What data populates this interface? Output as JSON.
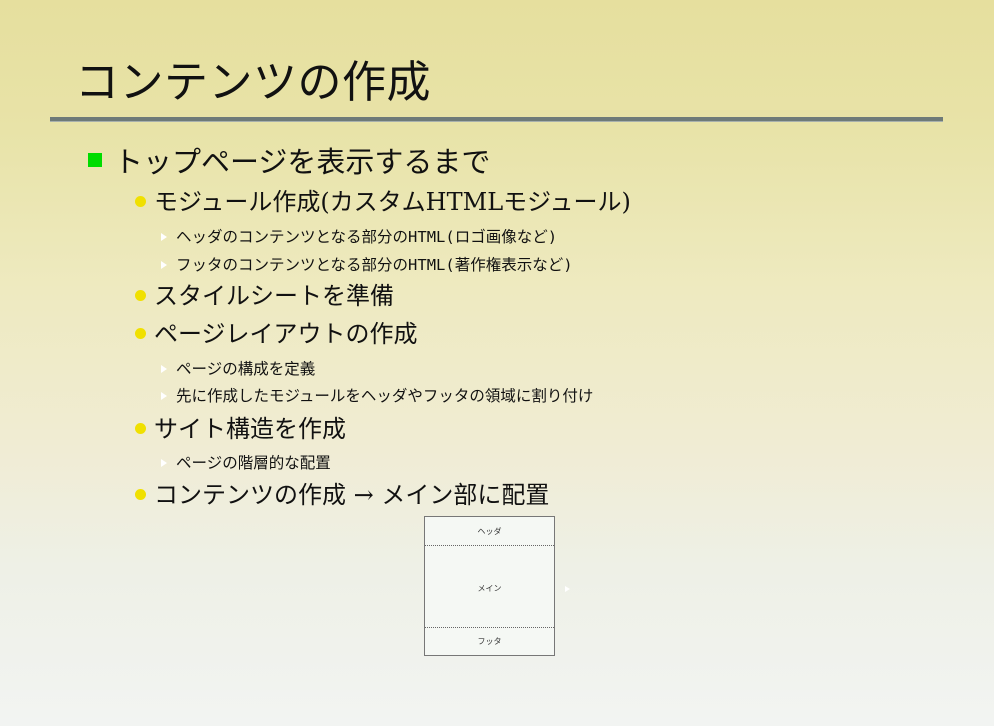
{
  "slide": {
    "title": "コンテンツの作成",
    "level1": {
      "text": "トップページを表示するまで"
    },
    "items": [
      {
        "text": "モジュール作成(カスタムHTMLモジュール)",
        "sub": [
          "ヘッダのコンテンツとなる部分のHTML(ロゴ画像など)",
          "フッタのコンテンツとなる部分のHTML(著作権表示など)"
        ]
      },
      {
        "text": "スタイルシートを準備",
        "sub": []
      },
      {
        "text": "ページレイアウトの作成",
        "sub": [
          "ページの構成を定義",
          "先に作成したモジュールをヘッダやフッタの領域に割り付け"
        ]
      },
      {
        "text": "サイト構造を作成",
        "sub": [
          "ページの階層的な配置"
        ]
      },
      {
        "text": "コンテンツの作成 → メイン部に配置",
        "sub": []
      }
    ],
    "diagram": {
      "header_label": "ヘッダ",
      "main_label": "メイン",
      "footer_label": "フッタ"
    }
  },
  "colors": {
    "level1_bullet": "#00dc00",
    "level2_bullet": "#f0e000",
    "title_rule": "#6e7a78"
  },
  "icons": {
    "level1_bullet": "green-square-bullet-icon",
    "level2_bullet": "yellow-dot-bullet-icon",
    "level3_bullet": "white-triangle-bullet-icon"
  }
}
